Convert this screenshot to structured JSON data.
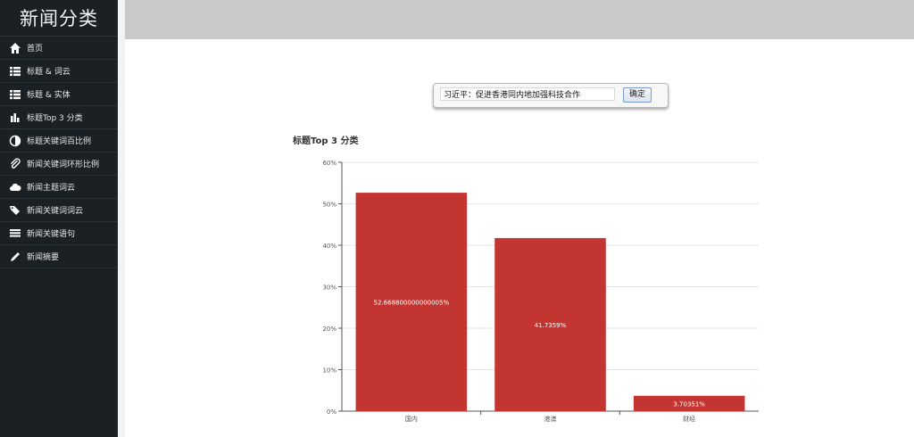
{
  "app": {
    "title": "新闻分类"
  },
  "sidebar": {
    "items": [
      {
        "label": "首页",
        "icon": "home-icon"
      },
      {
        "label": "标题 & 词云",
        "icon": "list-icon"
      },
      {
        "label": "标题 & 实体",
        "icon": "list-icon"
      },
      {
        "label": "标题Top 3 分类",
        "icon": "bar-chart-icon"
      },
      {
        "label": "标题关键词百比例",
        "icon": "contrast-icon"
      },
      {
        "label": "新闻关键词环形比例",
        "icon": "paperclip-icon"
      },
      {
        "label": "新闻主题词云",
        "icon": "cloud-icon"
      },
      {
        "label": "新闻关键词词云",
        "icon": "tags-icon"
      },
      {
        "label": "新闻关键语句",
        "icon": "align-justify-icon"
      },
      {
        "label": "新闻摘要",
        "icon": "pencil-icon"
      }
    ]
  },
  "search": {
    "value": "习近平：促进香港同内地加强科技合作",
    "button": "确定"
  },
  "chart_data": {
    "type": "bar",
    "title": "标题Top 3 分类",
    "categories": [
      "国内",
      "港澳",
      "财经"
    ],
    "values": [
      52.6688,
      41.7359,
      3.70351
    ],
    "value_labels": [
      "52.668800000000005%",
      "41.7359%",
      "3.70351%"
    ],
    "yticks": [
      "0%",
      "10%",
      "20%",
      "30%",
      "40%",
      "50%",
      "60%"
    ],
    "ylim": [
      0,
      60
    ],
    "bar_color": "#c23531",
    "grid": true
  }
}
